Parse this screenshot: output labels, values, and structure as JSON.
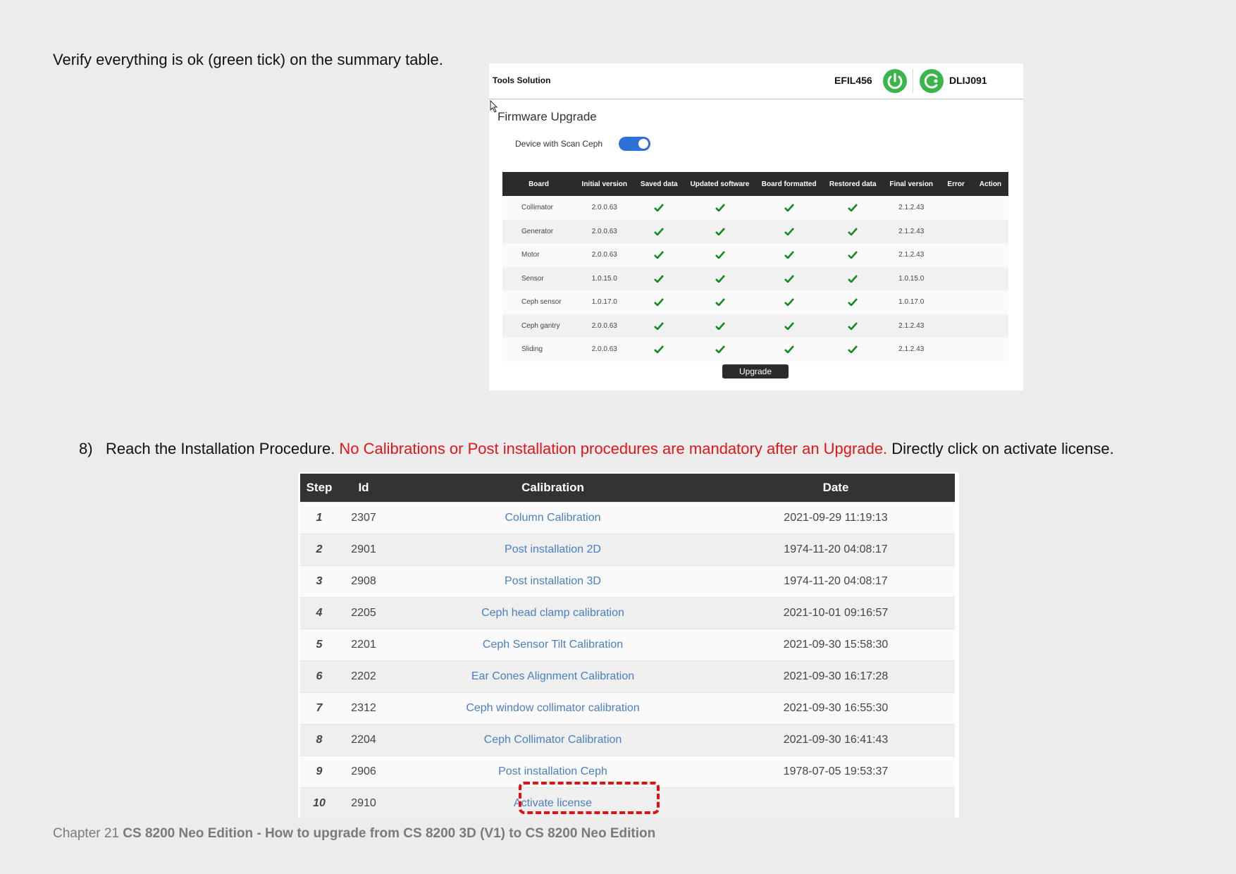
{
  "intro": {
    "text": "Verify everything is ok (green tick) on the summary table."
  },
  "firmware": {
    "brand": "Tools Solution",
    "device_left": "EFIL456",
    "device_right": "DLIJ091",
    "title": "Firmware Upgrade",
    "toggle_label": "Device with Scan Ceph",
    "toggle_on": true,
    "tick_color": "#118a1e",
    "status_color": "#3bb54a",
    "columns": [
      "Board",
      "Initial version",
      "Saved data",
      "Updated software",
      "Board formatted",
      "Restored data",
      "Final version",
      "Error",
      "Action"
    ],
    "rows": [
      {
        "board": "Collimator",
        "initial": "2.0.0.63",
        "final": "2.1.2.43"
      },
      {
        "board": "Generator",
        "initial": "2.0.0.63",
        "final": "2.1.2.43"
      },
      {
        "board": "Motor",
        "initial": "2.0.0.63",
        "final": "2.1.2.43"
      },
      {
        "board": "Sensor",
        "initial": "1.0.15.0",
        "final": "1.0.15.0"
      },
      {
        "board": "Ceph sensor",
        "initial": "1.0.17.0",
        "final": "1.0.17.0"
      },
      {
        "board": "Ceph gantry",
        "initial": "2.0.0.63",
        "final": "2.1.2.43"
      },
      {
        "board": "Sliding",
        "initial": "2.0.0.63",
        "final": "2.1.2.43"
      }
    ],
    "upgrade_label": "Upgrade"
  },
  "step8": {
    "number": "8)",
    "text_start": "Reach the Installation Procedure. ",
    "warning": "No Calibrations or Post installation procedures are mandatory after an Upgrade.",
    "text_end": " Directly click on activate license."
  },
  "calibration": {
    "columns": [
      "Step",
      "Id",
      "Calibration",
      "Date"
    ],
    "highlight_color": "#e01010",
    "rows": [
      {
        "step": "1",
        "id": "2307",
        "name": "Column Calibration",
        "date": "2021-09-29 11:19:13"
      },
      {
        "step": "2",
        "id": "2901",
        "name": "Post installation 2D",
        "date": "1974-11-20 04:08:17"
      },
      {
        "step": "3",
        "id": "2908",
        "name": "Post installation 3D",
        "date": "1974-11-20 04:08:17"
      },
      {
        "step": "4",
        "id": "2205",
        "name": "Ceph head clamp calibration",
        "date": "2021-10-01 09:16:57"
      },
      {
        "step": "5",
        "id": "2201",
        "name": "Ceph Sensor Tilt Calibration",
        "date": "2021-09-30 15:58:30"
      },
      {
        "step": "6",
        "id": "2202",
        "name": "Ear Cones Alignment Calibration",
        "date": "2021-09-30 16:17:28"
      },
      {
        "step": "7",
        "id": "2312",
        "name": "Ceph window collimator calibration",
        "date": "2021-09-30 16:55:30"
      },
      {
        "step": "8",
        "id": "2204",
        "name": "Ceph Collimator Calibration",
        "date": "2021-09-30 16:41:43"
      },
      {
        "step": "9",
        "id": "2906",
        "name": "Post installation Ceph",
        "date": "1978-07-05 19:53:37"
      },
      {
        "step": "10",
        "id": "2910",
        "name": "Activate license",
        "date": ""
      }
    ]
  },
  "footer": {
    "chapter": "Chapter 21 ",
    "title": "CS 8200 Neo Edition - How to upgrade from CS 8200 3D (V1) to CS 8200 Neo Edition"
  }
}
